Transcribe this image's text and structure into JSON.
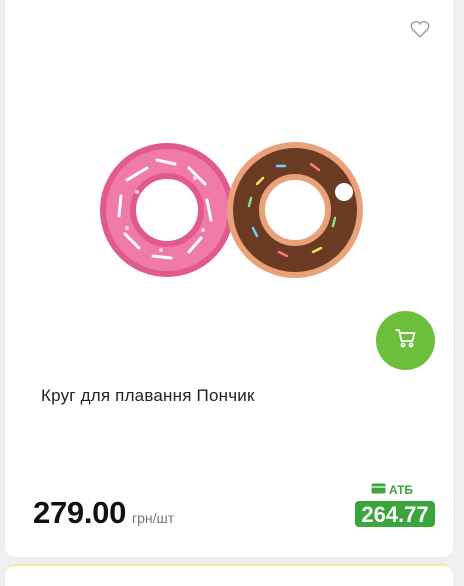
{
  "product": {
    "title": "Круг для плавання Пончик",
    "price": "279.00",
    "unit": "грн/шт",
    "promo_label": "АТБ",
    "promo_price": "264.77"
  },
  "icons": {
    "favorite": "heart-outline-icon",
    "cart": "shopping-cart-icon",
    "promo": "ticket-icon"
  },
  "colors": {
    "accent_green": "#6cbf3b",
    "promo_green": "#3aa53a"
  }
}
